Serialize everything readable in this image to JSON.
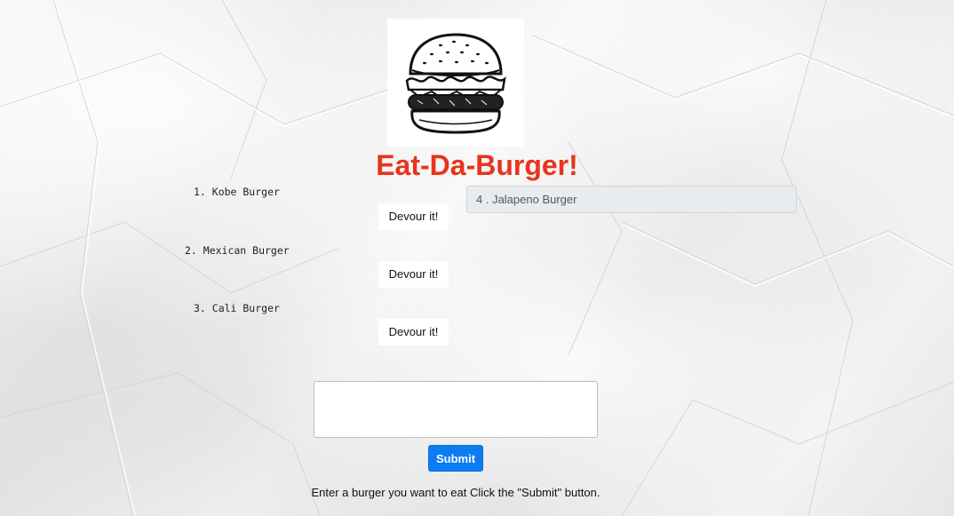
{
  "header": {
    "logo_name": "burger-logo",
    "title": "Eat-Da-Burger!",
    "title_color": "#e8341c"
  },
  "burgers": [
    {
      "label": "1. Kobe Burger",
      "button_label": "Devour it!"
    },
    {
      "label": "2. Mexican Burger",
      "button_label": "Devour it!"
    },
    {
      "label": "3. Cali Burger",
      "button_label": "Devour it!"
    }
  ],
  "devoured": [
    {
      "label": "4 . Jalapeno Burger"
    }
  ],
  "form": {
    "textarea_value": "",
    "submit_label": "Submit",
    "submit_color": "#0d7cf2",
    "instructions": "Enter a burger you want to eat Click the \"Submit\" button."
  }
}
